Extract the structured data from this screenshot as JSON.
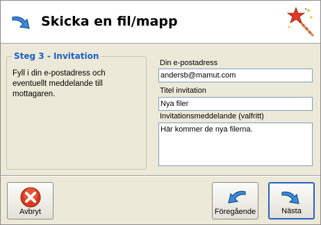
{
  "header": {
    "title": "Skicka en fil/mapp"
  },
  "step": {
    "legend": "Steg 3 - Invitation",
    "description": "Fyll i din e-postadress och eventuellt meddelande till mottagaren."
  },
  "form": {
    "email_label": "Din e-postadress",
    "email_value": "andersb@mamut.com",
    "title_label": "Titel invitation",
    "title_value": "Nya filer",
    "message_label": "Invitationsmeddelande (valfritt)",
    "message_value": "Här kommer de nya filerna."
  },
  "buttons": {
    "cancel": "Avbryt",
    "previous": "Föregående",
    "next": "Nästa"
  },
  "colors": {
    "accent": "#1c5ec7",
    "cancel_red": "#d93a1c",
    "arrow_blue": "#3a8ad9"
  }
}
